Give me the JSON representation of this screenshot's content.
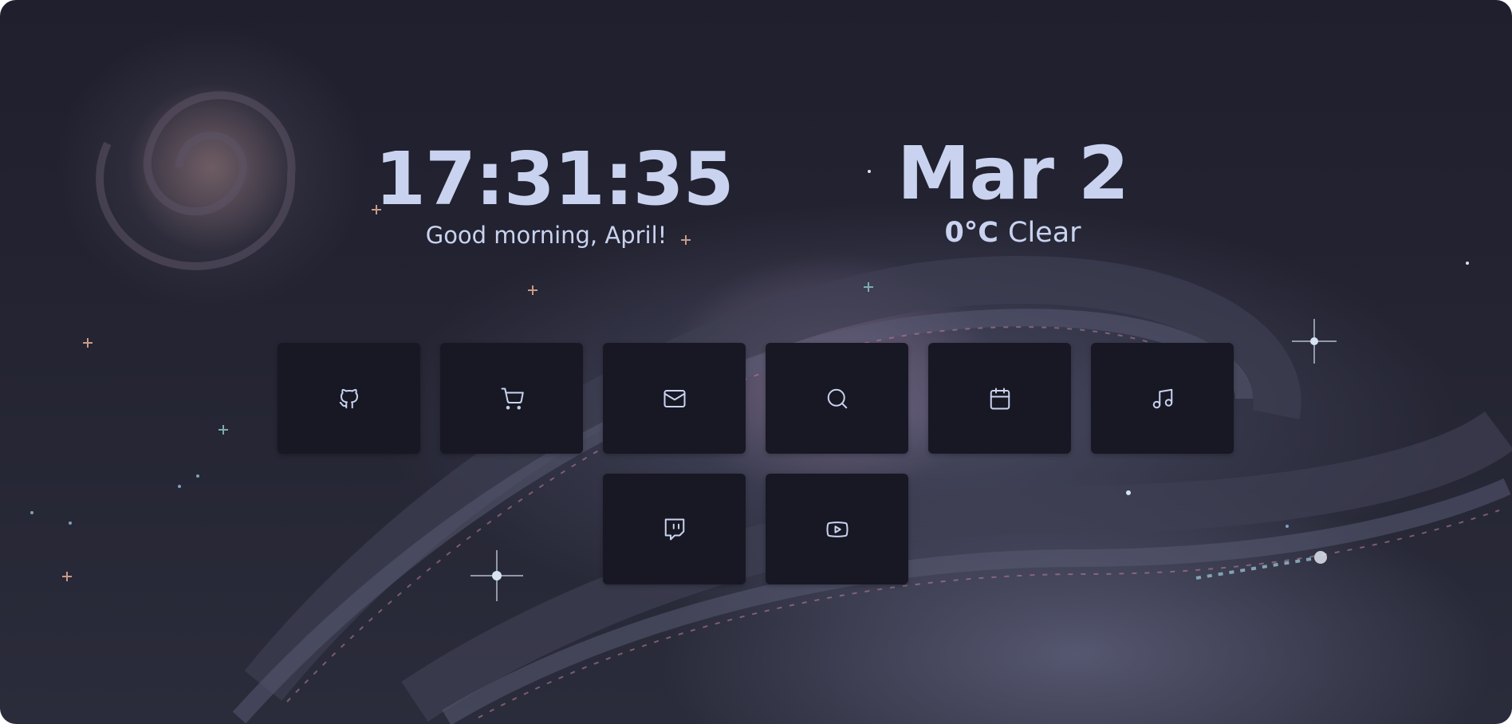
{
  "clock": {
    "time": "17:31:35",
    "greeting": "Good morning, April!"
  },
  "date": {
    "label": "Mar 2"
  },
  "weather": {
    "temperature": "0°C",
    "condition": "Clear"
  },
  "links": [
    {
      "icon": "github-icon"
    },
    {
      "icon": "shopping-cart-icon"
    },
    {
      "icon": "mail-icon"
    },
    {
      "icon": "search-icon"
    },
    {
      "icon": "calendar-icon"
    },
    {
      "icon": "music-icon"
    },
    {
      "icon": "twitch-icon"
    },
    {
      "icon": "youtube-icon"
    }
  ],
  "colors": {
    "text": "#c9d3ef",
    "tile_bg": "#181824",
    "background": "#232331"
  }
}
